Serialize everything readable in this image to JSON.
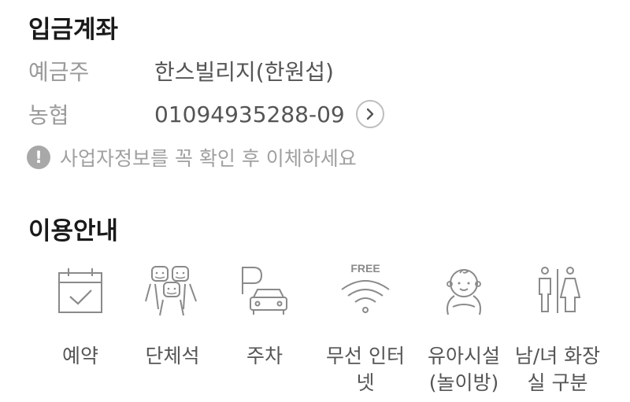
{
  "deposit": {
    "title": "입금계좌",
    "holder_label": "예금주",
    "holder_value": "한스빌리지(한원섭)",
    "bank_label": "농협",
    "account_number": "01094935288-09",
    "notice": "사업자정보를 꼭 확인 후 이체하세요",
    "notice_icon": "!"
  },
  "usage": {
    "title": "이용안내",
    "free_badge": "FREE",
    "amenities": [
      {
        "label": "예약",
        "icon": "calendar-check-icon"
      },
      {
        "label": "단체석",
        "icon": "group-seat-icon"
      },
      {
        "label": "주차",
        "icon": "parking-car-icon"
      },
      {
        "label": "무선 인터\n넷",
        "icon": "wifi-free-icon"
      },
      {
        "label": "유아시설\n(놀이방)",
        "icon": "baby-icon"
      },
      {
        "label": "남/녀 화장\n실 구분",
        "icon": "restroom-icon"
      }
    ]
  },
  "colors": {
    "title": "#1a1a1a",
    "label": "#9a9a9a",
    "value": "#555555",
    "icon_stroke": "#8a8a8a"
  }
}
